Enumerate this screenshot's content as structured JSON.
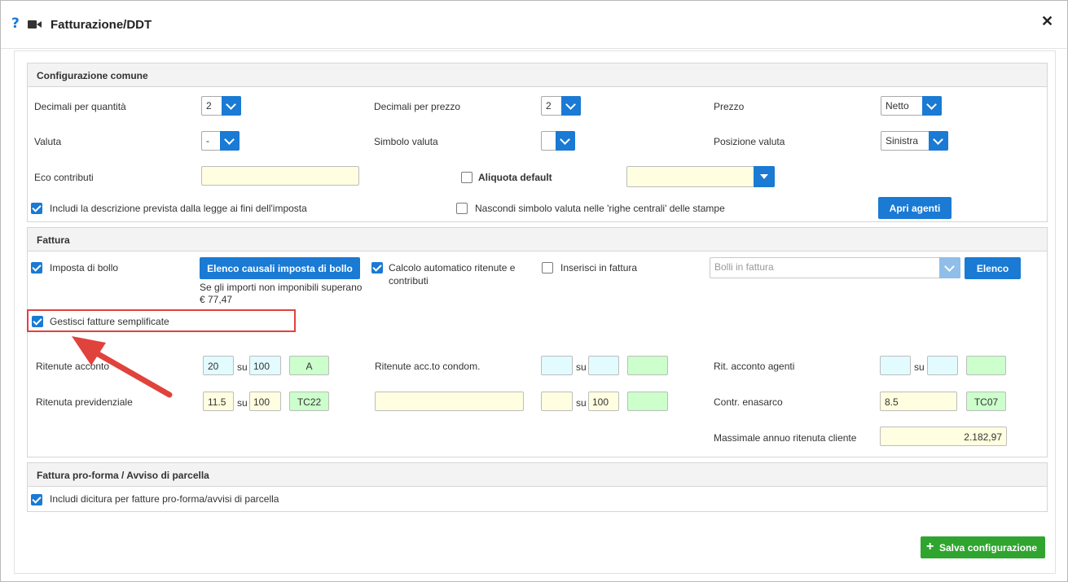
{
  "window": {
    "title": "Fatturazione/DDT",
    "help_glyph": "?",
    "close_glyph": "✕"
  },
  "colors": {
    "accent": "#1a7ad4",
    "save_green": "#2fa52f",
    "highlight_red": "#e0433c"
  },
  "common": {
    "title": "Configurazione comune",
    "dec_qty_label": "Decimali per quantità",
    "dec_qty_value": "2",
    "dec_price_label": "Decimali per prezzo",
    "dec_price_value": "2",
    "price_label": "Prezzo",
    "price_value": "Netto",
    "currency_label": "Valuta",
    "currency_value": "-",
    "currency_symbol_label": "Simbolo valuta",
    "currency_symbol_value": "",
    "currency_pos_label": "Posizione valuta",
    "currency_pos_value": "Sinistra",
    "eco_label": "Eco contributi",
    "eco_value": "",
    "aliquota_label": "Aliquota default",
    "aliquota_checked": false,
    "aliquota_value": "",
    "include_desc_label": "Includi la descrizione prevista dalla legge ai fini dell'imposta",
    "include_desc_checked": true,
    "hide_symbol_label": "Nascondi simbolo valuta nelle 'righe centrali' delle stampe",
    "hide_symbol_checked": false,
    "open_agents_button": "Apri agenti"
  },
  "invoice": {
    "title": "Fattura",
    "stamp_label": "Imposta di bollo",
    "stamp_checked": true,
    "stamp_list_button": "Elenco causali imposta di bollo",
    "stamp_note_line1": "Se gli importi non imponibili superano",
    "stamp_note_line2": "€ 77,47",
    "auto_calc_label_line1": "Calcolo automatico ritenute e",
    "auto_calc_label_line2": "contributi",
    "auto_calc_checked": true,
    "insert_label": "Inserisci in fattura",
    "insert_checked": false,
    "bolli_placeholder": "Bolli in fattura",
    "elenco_button": "Elenco",
    "simplified_label": "Gestisci fatture semplificate",
    "simplified_checked": true,
    "su": "su",
    "rit_acconto_label": "Ritenute acconto",
    "rit_acconto": [
      "20",
      "100",
      "A"
    ],
    "rit_condom_label": "Ritenute acc.to condom.",
    "rit_condom": [
      "",
      "",
      ""
    ],
    "rit_agenti_label": "Rit. acconto agenti",
    "rit_agenti": [
      "",
      "",
      ""
    ],
    "rit_prev_label": "Ritenuta previdenziale",
    "rit_prev": [
      "11.5",
      "100",
      "TC22"
    ],
    "rit_extra": [
      "",
      "",
      "100",
      ""
    ],
    "enasarco_label": "Contr. enasarco",
    "enasarco": [
      "8.5",
      "TC07"
    ],
    "massimale_label": "Massimale annuo ritenuta cliente",
    "massimale_value": "2.182,97"
  },
  "proforma": {
    "title": "Fattura pro-forma / Avviso di parcella",
    "include_label": "Includi dicitura per fatture pro-forma/avvisi di parcella",
    "include_checked": true
  },
  "footer": {
    "save_button": "Salva configurazione",
    "save_icon": "+"
  }
}
